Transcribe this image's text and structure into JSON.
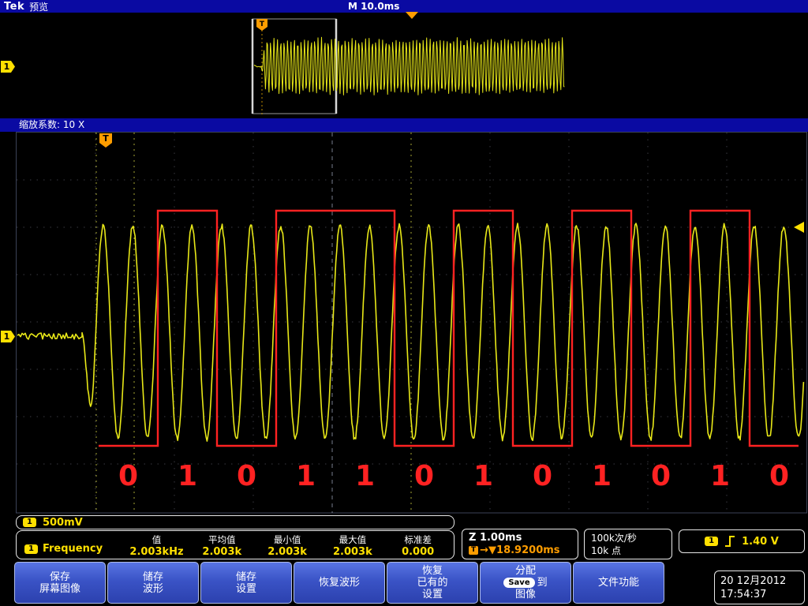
{
  "topbar": {
    "brand": "Tek",
    "mode": "预览",
    "timebase": "M 10.0ms"
  },
  "zoom_bar": {
    "label": "缩放系数: 10 X"
  },
  "markers": {
    "trigger_flag": "T"
  },
  "channel": {
    "number": "1",
    "scale": "500mV"
  },
  "measurement": {
    "channel": "1",
    "name": "Frequency",
    "columns": [
      {
        "header": "值",
        "value": "2.003kHz"
      },
      {
        "header": "平均值",
        "value": "2.003k"
      },
      {
        "header": "最小值",
        "value": "2.003k"
      },
      {
        "header": "最大值",
        "value": "2.003k"
      },
      {
        "header": "标准差",
        "value": "0.000"
      }
    ]
  },
  "zoom_info": {
    "scale": "Z 1.00ms",
    "trigger_flag": "T",
    "position": "→▼18.9200ms"
  },
  "acquisition": {
    "rate": "100k次/秒",
    "points": "10k 点"
  },
  "trigger": {
    "channel": "1",
    "slope_icon": "rising-edge",
    "level": "1.40 V"
  },
  "menu": [
    {
      "l1": "保存",
      "l2": "屏幕图像"
    },
    {
      "l1": "储存",
      "l2": "波形"
    },
    {
      "l1": "储存",
      "l2": "设置"
    },
    {
      "l1": "恢复波形"
    },
    {
      "l1": "恢复",
      "l2": "已有的",
      "l3": "设置"
    },
    {
      "l1": "分配",
      "badge": "Save",
      "l2": "到",
      "l3": "图像"
    },
    {
      "l1": "文件功能"
    }
  ],
  "datetime": {
    "date": "20 12月2012",
    "time": "17:54:37"
  },
  "waveform": {
    "bits": [
      "0",
      "1",
      "0",
      "1",
      "1",
      "0",
      "1",
      "0",
      "1",
      "0",
      "1",
      "0"
    ],
    "trace_color": "#e8e818",
    "overlay_color": "#ff2222",
    "grid_color": "#3a3a42",
    "cursor_color": "#b9b93a",
    "trigger_color": "#ff9d00"
  }
}
